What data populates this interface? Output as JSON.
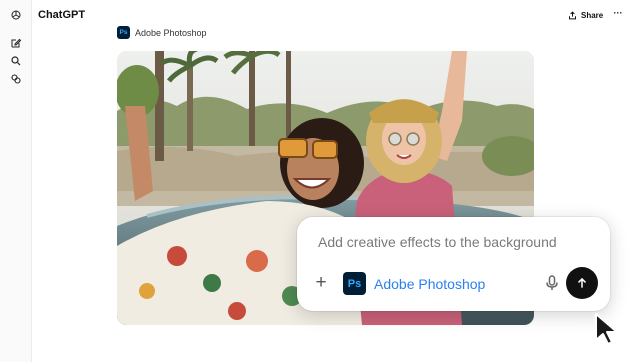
{
  "header": {
    "app_title": "ChatGPT",
    "share_label": "Share",
    "more_label": "···"
  },
  "sidebar": {
    "icons": [
      "new-chat-icon",
      "search-icon",
      "apps-icon"
    ]
  },
  "message": {
    "app_chip": {
      "logo_text": "Ps",
      "label": "Adobe Photoshop"
    },
    "image_alt": "Two smiling women in sunglasses riding in a convertible with desert palm trees behind"
  },
  "composer": {
    "input_text": "Add creative effects to the background",
    "plus_label": "+",
    "app_logo_text": "Ps",
    "app_label": "Adobe Photoshop"
  },
  "colors": {
    "photoshop_bg": "#001e36",
    "photoshop_fg": "#31a8ff",
    "link_blue": "#2b7ff0",
    "send_bg": "#111111"
  }
}
